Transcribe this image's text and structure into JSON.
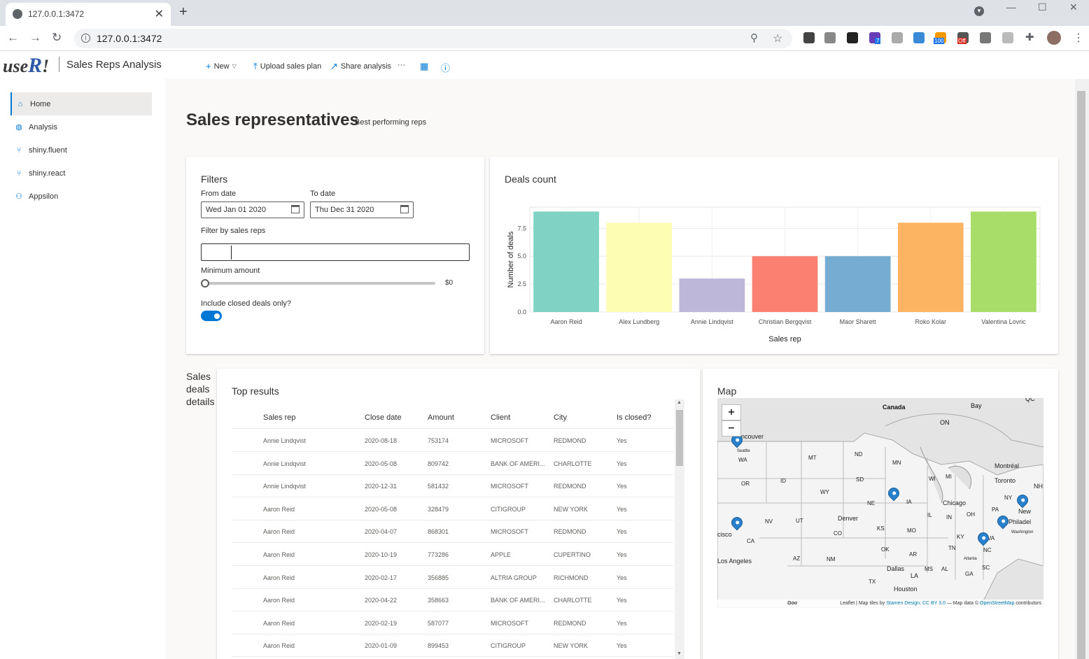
{
  "browser": {
    "tab_title": "127.0.0.1:3472",
    "url": "127.0.0.1:3472",
    "extension_badges": [
      "7",
      "100",
      "Off"
    ]
  },
  "app": {
    "logo_text": "use",
    "logo_r": "R",
    "logo_tail": "!",
    "title": "Sales Reps Analysis",
    "commands": {
      "new": "New",
      "upload": "Upload sales plan",
      "share": "Share analysis",
      "more": "···"
    }
  },
  "nav": {
    "items": [
      {
        "label": "Home",
        "icon": "home-icon"
      },
      {
        "label": "Analysis",
        "icon": "globe-icon"
      },
      {
        "label": "shiny.fluent",
        "icon": "branch-icon"
      },
      {
        "label": "shiny.react",
        "icon": "branch-icon"
      },
      {
        "label": "Appsilon",
        "icon": "people-icon"
      }
    ]
  },
  "page": {
    "title": "Sales representatives",
    "subtitle": "Best performing reps"
  },
  "filters": {
    "title": "Filters",
    "from_label": "From date",
    "from_value": "Wed Jan 01 2020",
    "to_label": "To date",
    "to_value": "Thu Dec 31 2020",
    "reps_label": "Filter by sales reps",
    "min_label": "Minimum amount",
    "min_value": "$0",
    "min_fraction": 0,
    "closed_label": "Include closed deals only?",
    "closed_on": true
  },
  "deals_chart": {
    "title": "Deals count"
  },
  "chart_data": {
    "type": "bar",
    "title": "",
    "xlabel": "Sales rep",
    "ylabel": "Number of deals",
    "categories": [
      "Aaron Reid",
      "Alex Lundberg",
      "Annie Lindqvist",
      "Christian Bergqvist",
      "Maor Sharett",
      "Roko Kolar",
      "Valentina Lovric"
    ],
    "values": [
      9,
      8,
      3,
      5,
      5,
      8,
      9
    ],
    "colors": [
      "#7fd3c4",
      "#fdfdb4",
      "#bdb7d9",
      "#fc8071",
      "#76abd2",
      "#fdb462",
      "#a7dd68"
    ],
    "ylim": [
      0,
      9.4
    ],
    "yticks": [
      "0.0",
      "2.5",
      "5.0",
      "7.5"
    ],
    "ytick_values": [
      0,
      2.5,
      5,
      7.5
    ],
    "grid": true
  },
  "details": {
    "section_label": "Sales deals details",
    "table_title": "Top results",
    "columns": [
      "Sales rep",
      "Close date",
      "Amount",
      "Client",
      "City",
      "Is closed?"
    ],
    "rows": [
      [
        "Annie Lindqvist",
        "2020-08-18",
        "753174",
        "MICROSOFT",
        "REDMOND",
        "Yes"
      ],
      [
        "Annie Lindqvist",
        "2020-05-08",
        "809742",
        "BANK OF AMERI...",
        "CHARLOTTE",
        "Yes"
      ],
      [
        "Annie Lindqvist",
        "2020-12-31",
        "581432",
        "MICROSOFT",
        "REDMOND",
        "Yes"
      ],
      [
        "Aaron Reid",
        "2020-05-08",
        "328479",
        "CITIGROUP",
        "NEW YORK",
        "Yes"
      ],
      [
        "Aaron Reid",
        "2020-04-07",
        "868301",
        "MICROSOFT",
        "REDMOND",
        "Yes"
      ],
      [
        "Aaron Reid",
        "2020-10-19",
        "773286",
        "APPLE",
        "CUPERTINO",
        "Yes"
      ],
      [
        "Aaron Reid",
        "2020-02-17",
        "356885",
        "ALTRIA GROUP",
        "RICHMOND",
        "Yes"
      ],
      [
        "Aaron Reid",
        "2020-04-22",
        "358663",
        "BANK OF AMERI...",
        "CHARLOTTE",
        "Yes"
      ],
      [
        "Aaron Reid",
        "2020-02-19",
        "587077",
        "MICROSOFT",
        "REDMOND",
        "Yes"
      ],
      [
        "Aaron Reid",
        "2020-01-09",
        "899453",
        "CITIGROUP",
        "NEW YORK",
        "Yes"
      ]
    ]
  },
  "map": {
    "title": "Map",
    "zoom_in": "+",
    "zoom_out": "−",
    "country_labels": [
      "Canada",
      "Bay",
      "QC",
      "ON"
    ],
    "state_labels": [
      "WA",
      "MT",
      "ND",
      "MN",
      "OR",
      "ID",
      "SD",
      "WY",
      "WI",
      "MI",
      "IA",
      "NE",
      "NV",
      "UT",
      "CO",
      "KS",
      "MO",
      "IL",
      "IN",
      "OH",
      "PA",
      "NY",
      "VA",
      "KY",
      "CA",
      "AZ",
      "NM",
      "OK",
      "AR",
      "TN",
      "NC",
      "MS",
      "AL",
      "GA",
      "SC",
      "TX"
    ],
    "city_labels": [
      "ncouver",
      "Seattle",
      "Montréal",
      "Toronto",
      "Chicago",
      "Denver",
      "Philadel",
      "Washington",
      "New",
      "cisco",
      "Los Angeles",
      "Dallas",
      "Houston",
      "Atlanta",
      "LA",
      "NH"
    ],
    "attribution_lead": "Leaflet | Map tiles by ",
    "attribution_stamen": "Stamen Design, CC BY 3.0",
    "attribution_mid": " — Map data © ",
    "attribution_osm": "OpenStreetMap",
    "attribution_tail": " contributors",
    "google_mark": "Goo"
  }
}
